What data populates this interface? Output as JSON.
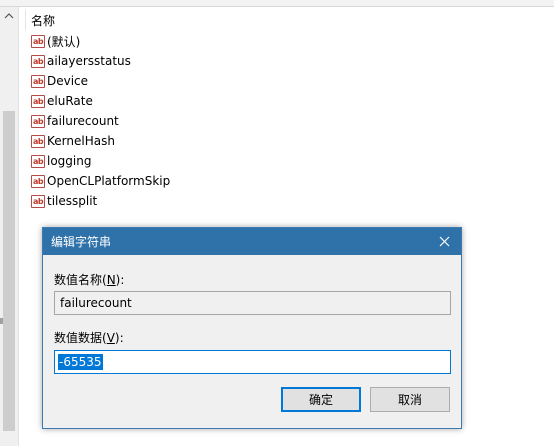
{
  "list": {
    "column_header": "名称",
    "rows": [
      {
        "icon": "ab",
        "label": "(默认)"
      },
      {
        "icon": "ab",
        "label": "ailayersstatus"
      },
      {
        "icon": "ab",
        "label": "Device"
      },
      {
        "icon": "ab",
        "label": "eluRate"
      },
      {
        "icon": "ab",
        "label": "failurecount"
      },
      {
        "icon": "ab",
        "label": "KernelHash"
      },
      {
        "icon": "ab",
        "label": "logging"
      },
      {
        "icon": "ab",
        "label": "OpenCLPlatformSkip"
      },
      {
        "icon": "ab",
        "label": "tilessplit"
      }
    ]
  },
  "dialog": {
    "title": "编辑字符串",
    "name_label": "数值名称(",
    "name_label_key": "N",
    "name_label_tail": "):",
    "name_value": "failurecount",
    "data_label": "数值数据(",
    "data_label_key": "V",
    "data_label_tail": "):",
    "data_value": "-65535",
    "ok_label": "确定",
    "cancel_label": "取消"
  },
  "scrollbar": {
    "up_icon": "chevron-up-icon"
  },
  "colors": {
    "title_bar": "#2f72aa",
    "selection": "#0078d7"
  }
}
